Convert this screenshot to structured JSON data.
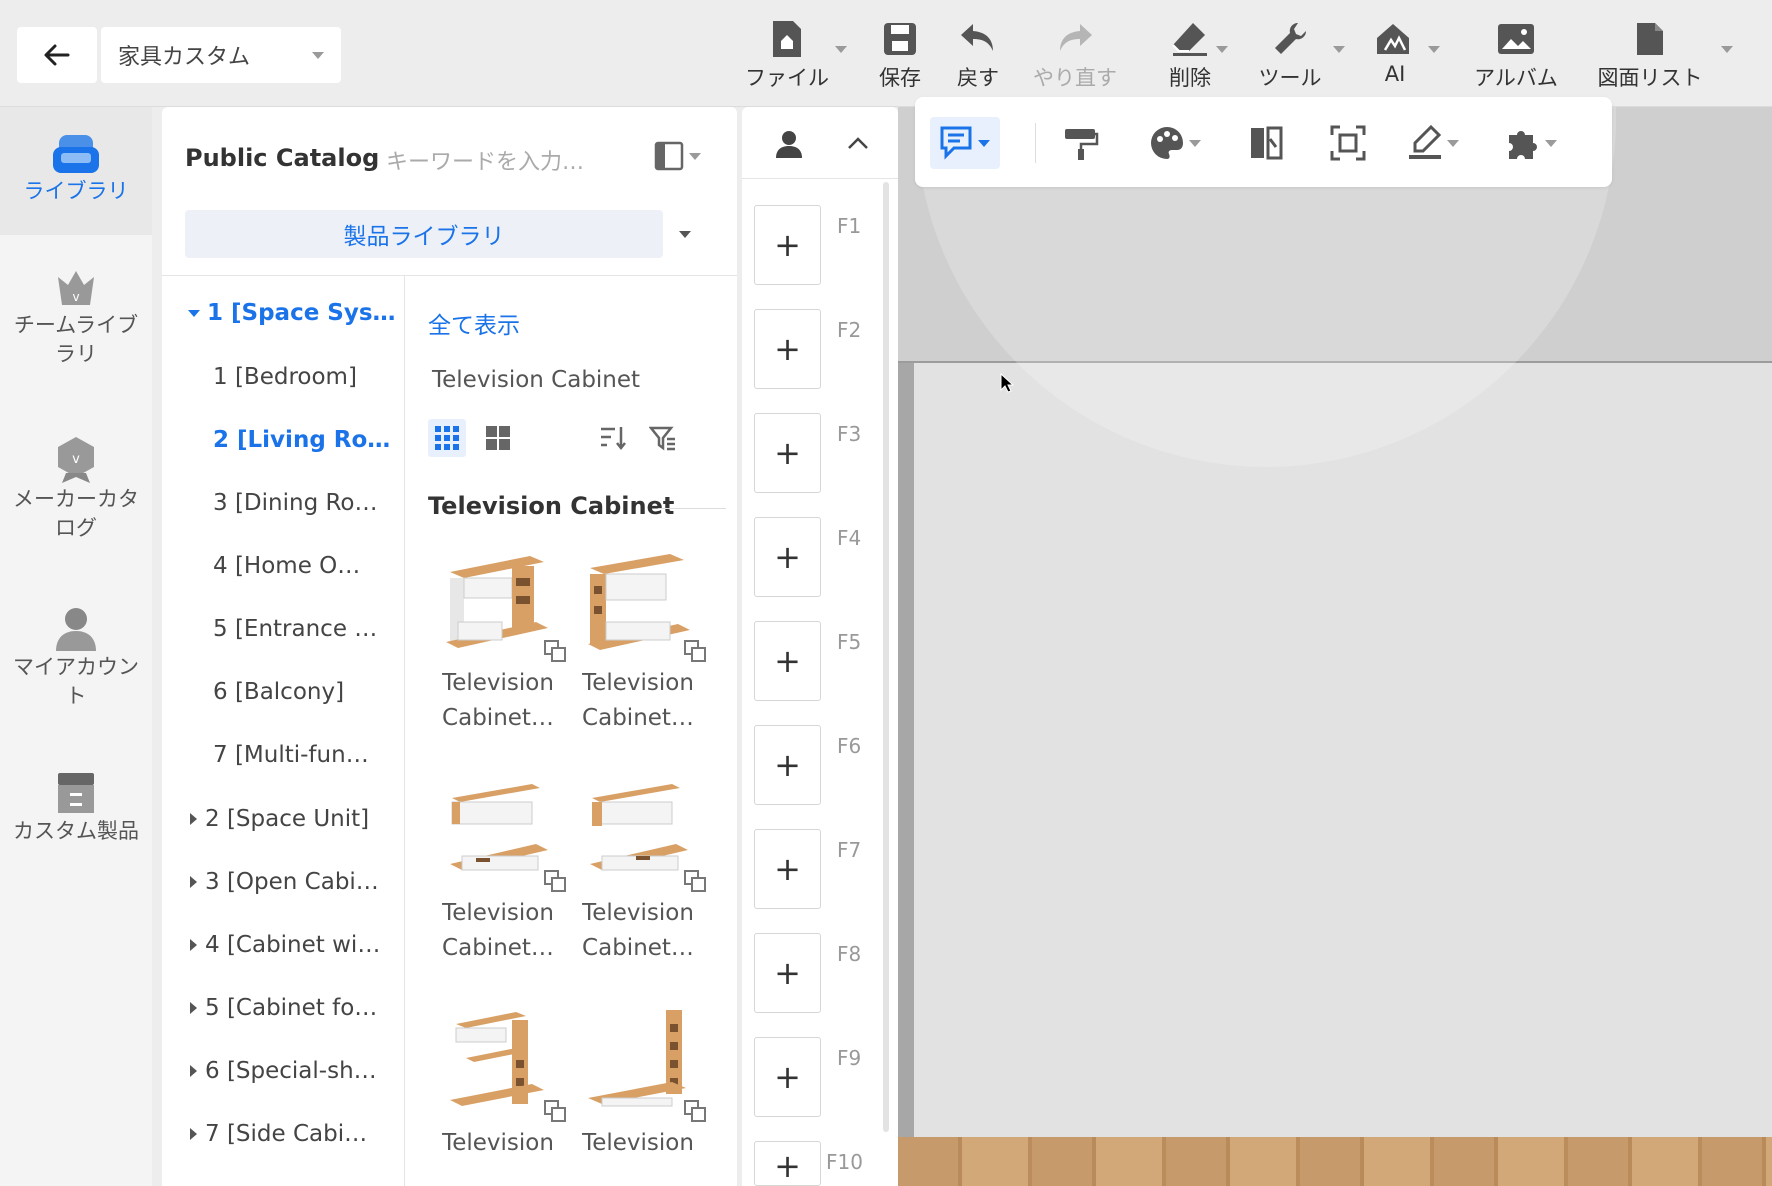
{
  "toolbar": {
    "project_name": "家具カスタム",
    "file": "ファイル",
    "save": "保存",
    "undo": "戻す",
    "redo": "やり直す",
    "delete": "削除",
    "tools": "ツール",
    "ai": "AI",
    "album": "アルバム",
    "drawing_list": "図面リスト"
  },
  "leftnav": {
    "library": "ライブラリ",
    "team_library": "チームライブラリ",
    "maker_catalog": "メーカーカタログ",
    "my_account": "マイアカウント",
    "custom_products": "カスタム製品"
  },
  "catalog": {
    "title": "Public Catalog",
    "search_placeholder": "キーワードを入力…",
    "library_select": "製品ライブラリ",
    "tree": [
      "1 [Space Sys…",
      "1 [Bedroom]",
      "2 [Living Ro…",
      "3 [Dining Ro…",
      "4 [Home O…",
      "5 [Entrance …",
      "6 [Balcony]",
      "7 [Multi-fun…",
      "2 [Space Unit]",
      "3 [Open Cabi…",
      "4 [Cabinet wi…",
      "5 [Cabinet fo…",
      "6 [Special-sh…",
      "7 [Side Cabi…"
    ],
    "show_all": "全て表示",
    "category": "Television Cabinet",
    "section_title": "Television Cabinet",
    "products": [
      {
        "line1": "Television",
        "line2": "Cabinet…"
      },
      {
        "line1": "Television",
        "line2": "Cabinet…"
      },
      {
        "line1": "Television",
        "line2": "Cabinet…"
      },
      {
        "line1": "Television",
        "line2": "Cabinet…"
      },
      {
        "line1": "Television",
        "line2": ""
      },
      {
        "line1": "Television",
        "line2": ""
      }
    ]
  },
  "floors": [
    "F1",
    "F2",
    "F3",
    "F4",
    "F5",
    "F6",
    "F7",
    "F8",
    "F9",
    "F10"
  ],
  "floor_add_symbol": "+",
  "colors": {
    "accent": "#1a73e8",
    "wood": "#d9a066",
    "icon_gray": "#555555"
  }
}
